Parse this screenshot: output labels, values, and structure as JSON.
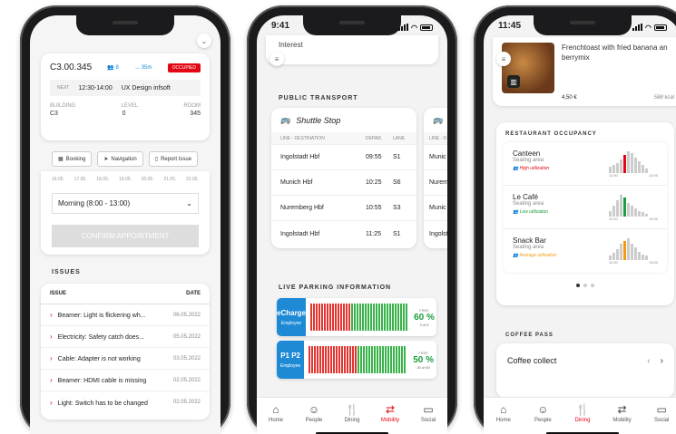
{
  "phone1": {
    "room": "C3.00.345",
    "people": "8",
    "distance": "35m",
    "status": "OCCUPIED",
    "next_label": "NEXT",
    "next_time": "12:30-14:00",
    "next_event": "UX Design infsoft",
    "building_label": "BUILDING",
    "building": "C3",
    "level_label": "LEVEL",
    "level": "0",
    "room_label": "ROOM",
    "room_no": "345",
    "buttons": [
      "Booking",
      "Navigation",
      "Report Issue"
    ],
    "times": [
      "16.05.",
      "17.05.",
      "18.05.",
      "19.05.",
      "20.05.",
      "21.05.",
      "22.05."
    ],
    "slot": "Morning (8:00 - 13:00)",
    "confirm": "CONFIRM APPOINTMENT",
    "issues_title": "ISSUES",
    "col_issue": "ISSUE",
    "col_date": "DATE",
    "issues": [
      {
        "text": "Beamer: Light is flickering wh...",
        "date": "06.05.2022"
      },
      {
        "text": "Electricity: Safety catch does...",
        "date": "05.05.2022"
      },
      {
        "text": "Cable: Adapter is not working",
        "date": "03.05.2022"
      },
      {
        "text": "Beamer: HDMI cable is missing",
        "date": "02.05.2022"
      },
      {
        "text": "Light: Switch has to be changed",
        "date": "02.05.2022"
      }
    ]
  },
  "phone2": {
    "time": "9:41",
    "interest": "Interest",
    "pt_title": "PUBLIC TRANSPORT",
    "card_title": "Shuttle Stop",
    "col_line": "LINE - DESTINATION",
    "col_dep": "DEPAR.",
    "col_lane": "LANE",
    "col_line2": "LINE - D",
    "rows": [
      {
        "dest": "Ingolstadt Hbf",
        "dep": "09:55",
        "lane": "S1",
        "dest2": "Munic"
      },
      {
        "dest": "Munich Hbf",
        "dep": "10:25",
        "lane": "S6",
        "dest2": "Nurem"
      },
      {
        "dest": "Nuremberg Hbf",
        "dep": "10:55",
        "lane": "S3",
        "dest2": "Munic"
      },
      {
        "dest": "Ingolstadt Hbf",
        "dep": "11:25",
        "lane": "S1",
        "dest2": "Ingolst"
      }
    ],
    "parking_title": "LIVE PARKING INFORMATION",
    "parking": [
      {
        "name": "eCharge",
        "sub": "Employee",
        "free": "FREE",
        "pct": "60 %",
        "count": "3 of 5",
        "red": 15,
        "green": 21
      },
      {
        "name": "P1  P2",
        "sub": "Employee",
        "free": "FREE",
        "pct": "50 %",
        "count": "30 of 60",
        "red": 18,
        "green": 18
      }
    ]
  },
  "phone3": {
    "time": "11:45",
    "food_title": "Frenchtoast with fried banana an berrymix",
    "price": "4,50 €",
    "kcal": "588 kcal",
    "occ_title": "RESTAURANT OCCUPANCY",
    "restaurants": [
      {
        "name": "Canteen",
        "sub": "Seating area",
        "util": "High utilization",
        "color": "#e30613",
        "bars": [
          6,
          8,
          10,
          14,
          18,
          22,
          20,
          16,
          12,
          8,
          5
        ]
      },
      {
        "name": "Le Café",
        "sub": "Seating area",
        "util": "Low utilization",
        "color": "#1c9e3c",
        "bars": [
          4,
          8,
          12,
          16,
          14,
          10,
          8,
          6,
          4,
          3,
          2
        ]
      },
      {
        "name": "Snack Bar",
        "sub": "Seating area",
        "util": "Average utilization",
        "color": "#f39c12",
        "bars": [
          3,
          5,
          8,
          12,
          14,
          16,
          12,
          9,
          6,
          4,
          3
        ]
      }
    ],
    "t1": "11:00",
    "t2": "13:00",
    "coffee_title": "COFFEE PASS",
    "coffee": "Coffee collect"
  },
  "tabs": [
    "Home",
    "People",
    "Dining",
    "Mobility",
    "Social"
  ]
}
